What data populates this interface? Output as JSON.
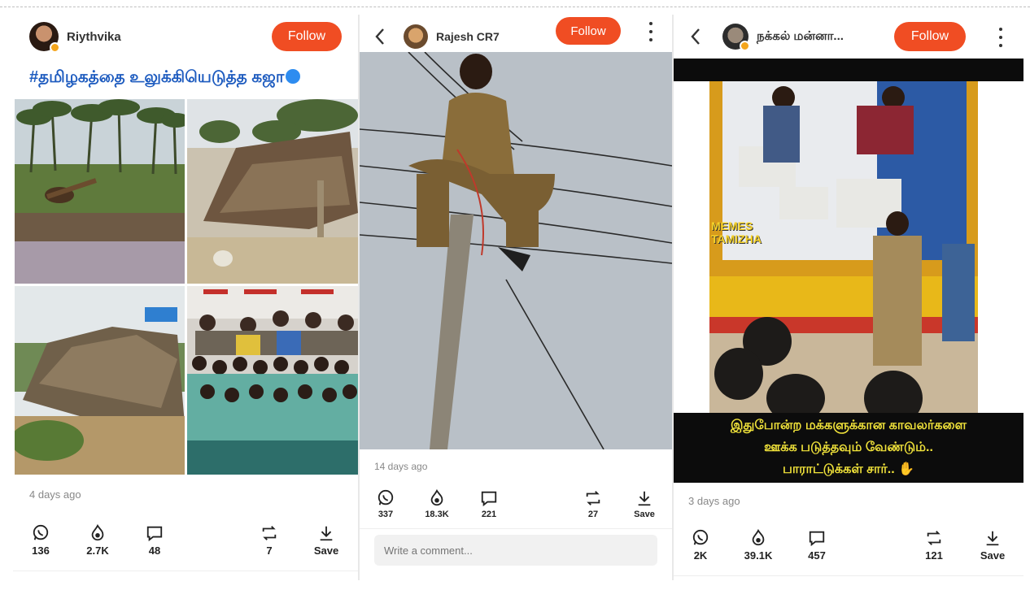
{
  "panel1": {
    "username": "Riythvika",
    "follow_label": "Follow",
    "hashtag": "#தமிழகத்தை உலுக்கியெடுத்த கஜா",
    "time_ago": "4 days ago",
    "stats": {
      "whatsapp": "136",
      "likes": "2.7K",
      "comments": "48",
      "reposts": "7",
      "save": "Save"
    }
  },
  "panel2": {
    "username": "Rajesh CR7",
    "follow_label": "Follow",
    "time_ago": "14 days ago",
    "stats": {
      "whatsapp": "337",
      "likes": "18.3K",
      "comments": "221",
      "reposts": "27",
      "save": "Save"
    },
    "comment_placeholder": "Write a comment..."
  },
  "panel3": {
    "username": "நக்கல் மன்னா...",
    "follow_label": "Follow",
    "image_caption_line1": "இதுபோன்ற மக்களுக்கான காவலர்களை",
    "image_caption_line2": "ஊக்க படுத்தவும் வேண்டும்..",
    "image_caption_line3": "பாராட்டுக்கள் சார்..",
    "watermark_line1": "MEMES",
    "watermark_line2": "TAMIZHA",
    "time_ago": "3 days ago",
    "stats": {
      "whatsapp": "2K",
      "likes": "39.1K",
      "comments": "457",
      "reposts": "121",
      "save": "Save"
    }
  },
  "colors": {
    "follow": "#f04d23",
    "hashtag": "#1d5bbf",
    "caption_text": "#f0e23a"
  }
}
